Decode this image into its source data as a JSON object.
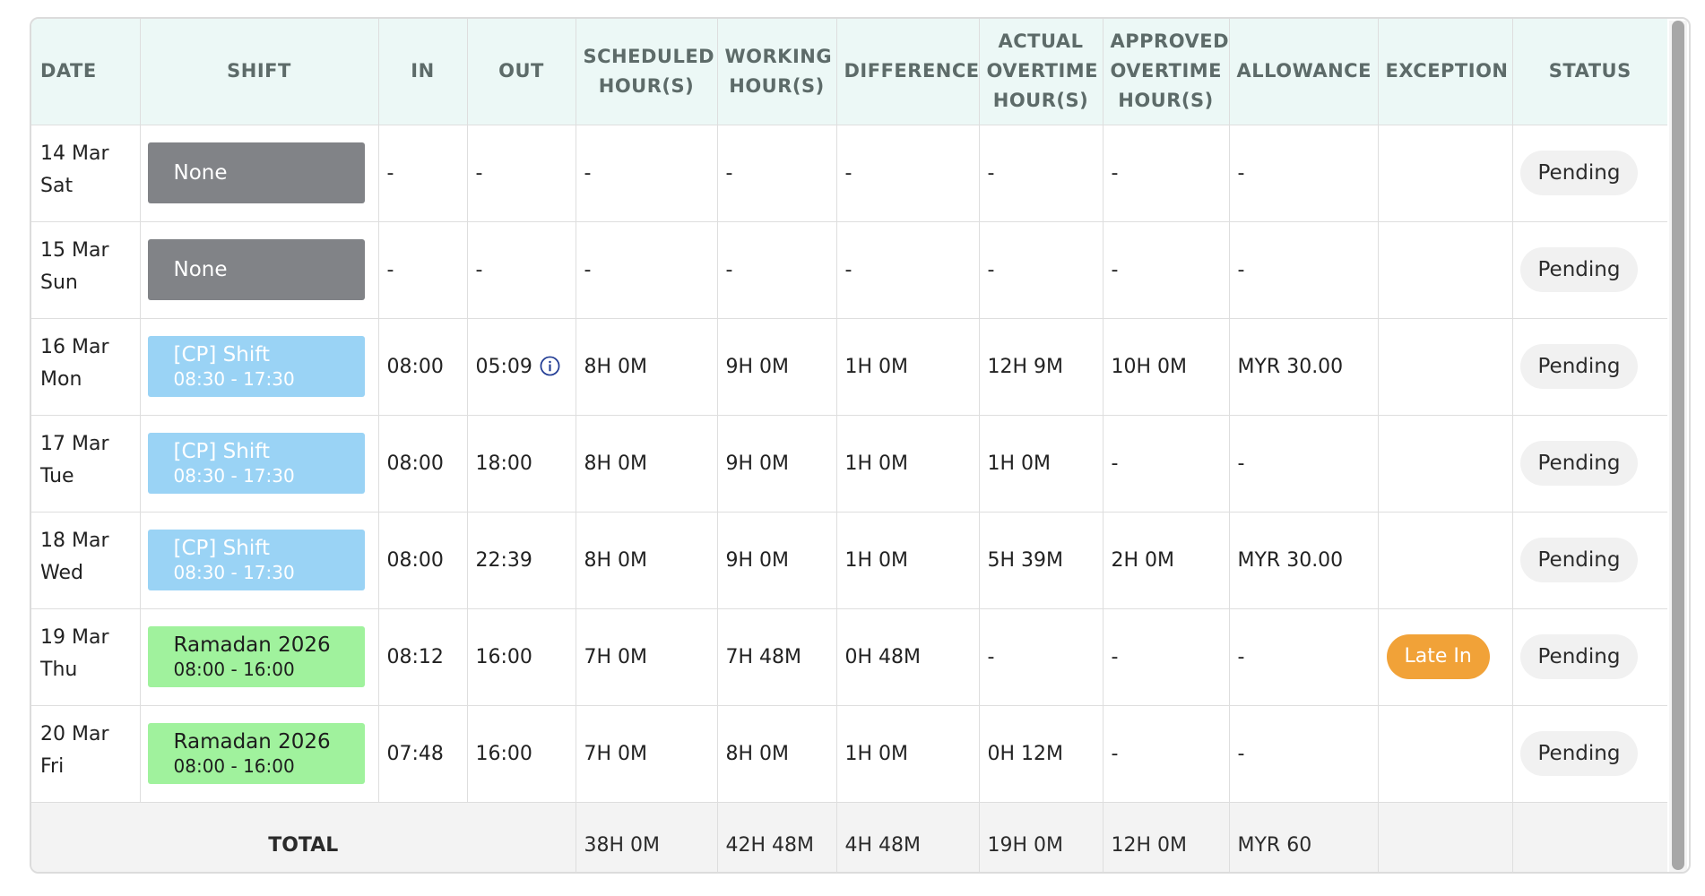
{
  "headers": {
    "date": "DATE",
    "shift": "SHIFT",
    "in": "IN",
    "out": "OUT",
    "scheduled_l1": "SCHEDULED",
    "scheduled_l2": "HOUR(S)",
    "working_l1": "WORKING",
    "working_l2": "HOUR(S)",
    "difference": "DIFFERENCE",
    "actual_l1": "ACTUAL",
    "actual_l2": "OVERTIME",
    "actual_l3": "HOUR(S)",
    "approved_l1": "APPROVED",
    "approved_l2": "OVERTIME",
    "approved_l3": "HOUR(S)",
    "allowance": "ALLOWANCE",
    "exception": "EXCEPTION",
    "status": "STATUS"
  },
  "rows": [
    {
      "date_day": "14 Mar",
      "date_wd": "Sat",
      "shift_type": "none",
      "shift_name": "None",
      "shift_time": "",
      "in": "-",
      "out": "-",
      "out_info": false,
      "scheduled": "-",
      "working": "-",
      "difference": "-",
      "actual_ot": "-",
      "approved_ot": "-",
      "allowance": "-",
      "exception": "",
      "status": "Pending"
    },
    {
      "date_day": "15 Mar",
      "date_wd": "Sun",
      "shift_type": "none",
      "shift_name": "None",
      "shift_time": "",
      "in": "-",
      "out": "-",
      "out_info": false,
      "scheduled": "-",
      "working": "-",
      "difference": "-",
      "actual_ot": "-",
      "approved_ot": "-",
      "allowance": "-",
      "exception": "",
      "status": "Pending"
    },
    {
      "date_day": "16 Mar",
      "date_wd": "Mon",
      "shift_type": "cp",
      "shift_name": "[CP] Shift",
      "shift_time": "08:30 - 17:30",
      "in": "08:00",
      "out": "05:09",
      "out_info": true,
      "scheduled": "8H 0M",
      "working": "9H 0M",
      "difference": "1H 0M",
      "actual_ot": "12H 9M",
      "approved_ot": "10H 0M",
      "allowance": "MYR 30.00",
      "exception": "",
      "status": "Pending"
    },
    {
      "date_day": "17 Mar",
      "date_wd": "Tue",
      "shift_type": "cp",
      "shift_name": "[CP] Shift",
      "shift_time": "08:30 - 17:30",
      "in": "08:00",
      "out": "18:00",
      "out_info": false,
      "scheduled": "8H 0M",
      "working": "9H 0M",
      "difference": "1H 0M",
      "actual_ot": "1H 0M",
      "approved_ot": "-",
      "allowance": "-",
      "exception": "",
      "status": "Pending"
    },
    {
      "date_day": "18 Mar",
      "date_wd": "Wed",
      "shift_type": "cp",
      "shift_name": "[CP] Shift",
      "shift_time": "08:30 - 17:30",
      "in": "08:00",
      "out": "22:39",
      "out_info": false,
      "scheduled": "8H 0M",
      "working": "9H 0M",
      "difference": "1H 0M",
      "actual_ot": "5H 39M",
      "approved_ot": "2H 0M",
      "allowance": "MYR 30.00",
      "exception": "",
      "status": "Pending"
    },
    {
      "date_day": "19 Mar",
      "date_wd": "Thu",
      "shift_type": "ram",
      "shift_name": "Ramadan 2026",
      "shift_time": "08:00 - 16:00",
      "in": "08:12",
      "out": "16:00",
      "out_info": false,
      "scheduled": "7H 0M",
      "working": "7H 48M",
      "difference": "0H 48M",
      "actual_ot": "-",
      "approved_ot": "-",
      "allowance": "-",
      "exception": "Late In",
      "status": "Pending"
    },
    {
      "date_day": "20 Mar",
      "date_wd": "Fri",
      "shift_type": "ram",
      "shift_name": "Ramadan 2026",
      "shift_time": "08:00 - 16:00",
      "in": "07:48",
      "out": "16:00",
      "out_info": false,
      "scheduled": "7H 0M",
      "working": "8H 0M",
      "difference": "1H 0M",
      "actual_ot": "0H 12M",
      "approved_ot": "-",
      "allowance": "-",
      "exception": "",
      "status": "Pending"
    }
  ],
  "total": {
    "label": "TOTAL",
    "scheduled": "38H 0M",
    "working": "42H 48M",
    "difference": "4H 48M",
    "actual_ot": "19H 0M",
    "approved_ot": "12H 0M",
    "allowance": "MYR 60"
  },
  "colors": {
    "header_bg": "#ecf8f6",
    "shift_none": "#818387",
    "shift_cp": "#9ad3f5",
    "shift_ramadan": "#a0f29d",
    "late_badge": "#f1a238",
    "pending_badge": "#f1f1f1",
    "info_icon": "#1f3a93"
  },
  "icons": {
    "out_info": "info-icon"
  }
}
